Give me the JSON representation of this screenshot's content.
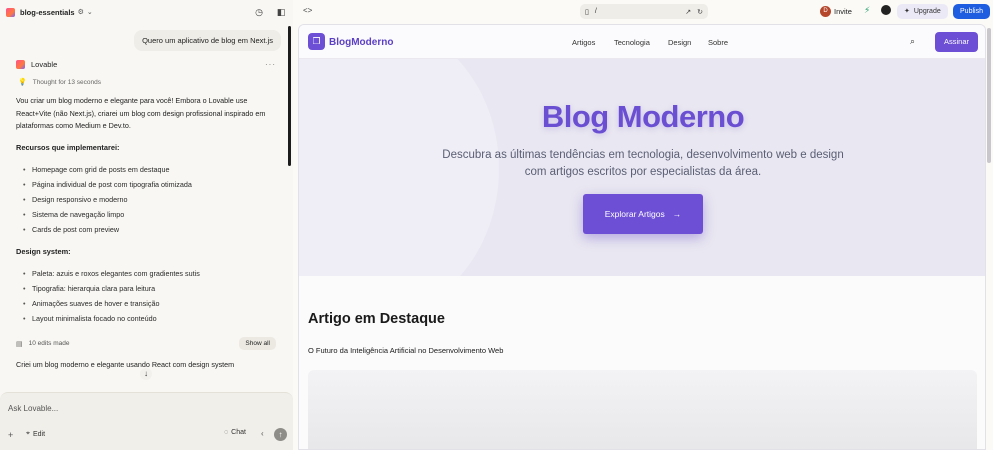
{
  "chat": {
    "project_name": "blog-essentials",
    "user_message": "Quero um aplicativo de blog em Next.js",
    "assistant_name": "Lovable",
    "more": "···",
    "thought": "Thought for 13 seconds",
    "intro": "Vou criar um blog moderno e elegante para você! Embora o Lovable use React+Vite (não Next.js), criarei um blog com design profissional inspirado em plataformas como Medium e Dev.to.",
    "features_heading": "Recursos que implementarei:",
    "features": [
      "Homepage com grid de posts em destaque",
      "Página individual de post com tipografia otimizada",
      "Design responsivo e moderno",
      "Sistema de navegação limpo",
      "Cards de post com preview"
    ],
    "design_heading": "Design system:",
    "design_items": [
      "Paleta: azuis e roxos elegantes com gradientes sutis",
      "Tipografia: hierarquia clara para leitura",
      "Animações suaves de hover e transição",
      "Layout minimalista focado no conteúdo"
    ],
    "edits_label": "10 edits made",
    "show_all": "Show all",
    "final_line": "Criei um blog moderno e elegante usando React com design system",
    "input_placeholder": "Ask Lovable...",
    "edit_label": "Edit",
    "chat_label": "Chat"
  },
  "topbar": {
    "route": "/",
    "avatar_initial": "D",
    "invite": "Invite",
    "upgrade": "Upgrade",
    "publish": "Publish"
  },
  "site": {
    "brand": "BlogModerno",
    "nav": [
      "Artigos",
      "Tecnologia",
      "Design",
      "Sobre"
    ],
    "subscribe": "Assinar",
    "hero_title": "Blog Moderno",
    "hero_subtitle": "Descubra as últimas tendências em tecnologia, desenvolvimento web e design com artigos escritos por especialistas da área.",
    "hero_cta": "Explorar Artigos",
    "featured_title": "Artigo em Destaque",
    "featured_post": "O Futuro da Inteligência Artificial no Desenvolvimento Web"
  },
  "colors": {
    "brand_purple": "#6d4fd6",
    "publish_blue": "#1f5de0"
  }
}
